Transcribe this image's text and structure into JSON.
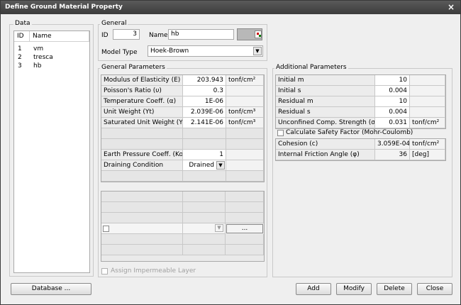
{
  "window": {
    "title": "Define Ground Material Property",
    "close_glyph": "×"
  },
  "data_panel": {
    "legend": "Data",
    "columns": [
      "ID",
      "Name"
    ],
    "rows": [
      {
        "id": "1",
        "name": "vm"
      },
      {
        "id": "2",
        "name": "tresca"
      },
      {
        "id": "3",
        "name": "hb"
      }
    ]
  },
  "general": {
    "legend": "General",
    "id_label": "ID",
    "id_value": "3",
    "name_label": "Name",
    "name_value": "hb",
    "model_type_label": "Model Type",
    "model_type_value": "Hoek-Brown"
  },
  "general_parameters": {
    "legend": "General Parameters",
    "rows": [
      {
        "label": "Modulus of Elasticity (E)",
        "value": "203.943",
        "unit": "tonf/cm²"
      },
      {
        "label": "Poisson's Ratio (υ)",
        "value": "0.3",
        "unit": ""
      },
      {
        "label": "Temperature Coeff. (α)",
        "value": "1E-06",
        "unit": ""
      },
      {
        "label": "Unit Weight (Yt)",
        "value": "2.039E-06",
        "unit": "tonf/cm³"
      },
      {
        "label": "Saturated Unit Weight (Ysat)",
        "value": "2.141E-06",
        "unit": "tonf/cm³"
      }
    ],
    "earth_pressure_label": "Earth Pressure Coeff. (Ko)",
    "earth_pressure_value": "1",
    "draining_label": "Draining Condition",
    "draining_value": "Drained",
    "ellipsis_label": "...",
    "impermeable_label": "Assign Impermeable Layer"
  },
  "additional_parameters": {
    "legend": "Additional Parameters",
    "rows": [
      {
        "label": "Initial m",
        "value": "10",
        "unit": ""
      },
      {
        "label": "Initial s",
        "value": "0.004",
        "unit": ""
      },
      {
        "label": "Residual m",
        "value": "10",
        "unit": ""
      },
      {
        "label": "Residual s",
        "value": "0.004",
        "unit": ""
      },
      {
        "label": "Unconfined Comp. Strength (σc)",
        "value": "0.031",
        "unit": "tonf/cm²"
      }
    ],
    "safety_factor_label": "Calculate Safety Factor (Mohr-Coulomb)",
    "rows2": [
      {
        "label": "Cohesion (c)",
        "value": "3.059E-04",
        "unit": "tonf/cm²"
      },
      {
        "label": "Internal Friction Angle (φ)",
        "value": "36",
        "unit": "[deg]"
      }
    ]
  },
  "buttons": {
    "database": "Database ...",
    "add": "Add",
    "modify": "Modify",
    "delete": "Delete",
    "close": "Close"
  }
}
